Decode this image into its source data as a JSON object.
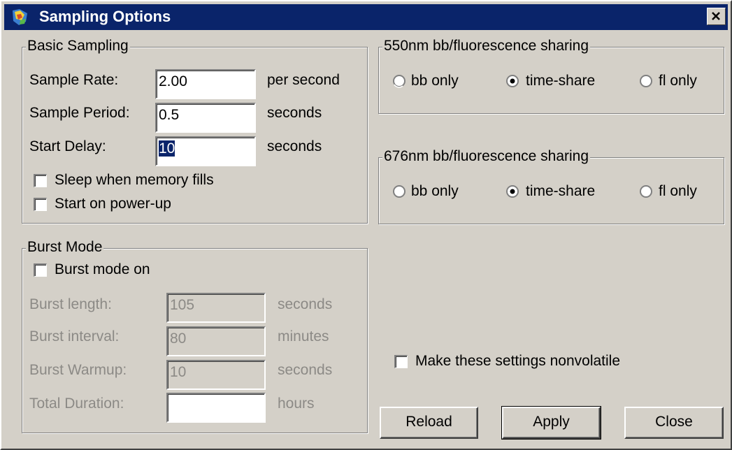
{
  "window": {
    "title": "Sampling Options",
    "close_icon": "close-icon",
    "app_icon": "app-icon"
  },
  "basic_sampling": {
    "legend": "Basic Sampling",
    "sample_rate": {
      "label": "Sample Rate:",
      "value": "2.00",
      "unit": "per second"
    },
    "sample_period": {
      "label": "Sample Period:",
      "value": "0.5",
      "unit": "seconds"
    },
    "start_delay": {
      "label": "Start Delay:",
      "value": "10",
      "unit": "seconds",
      "selected": true
    },
    "sleep_when_memory_fills": {
      "label": "Sleep when memory fills",
      "checked": false
    },
    "start_on_power_up": {
      "label": "Start on power-up",
      "checked": false
    }
  },
  "burst_mode": {
    "legend": "Burst Mode",
    "burst_mode_on": {
      "label": "Burst mode on",
      "checked": false
    },
    "burst_length": {
      "label": "Burst length:",
      "value": "105",
      "unit": "seconds"
    },
    "burst_interval": {
      "label": "Burst interval:",
      "value": "80",
      "unit": "minutes"
    },
    "burst_warmup": {
      "label": "Burst Warmup:",
      "value": "10",
      "unit": "seconds"
    },
    "total_duration": {
      "label": "Total Duration:",
      "value": "",
      "unit": "hours"
    }
  },
  "sharing_550": {
    "legend": "550nm bb/fluorescence sharing",
    "options": [
      {
        "label": "bb only",
        "selected": false
      },
      {
        "label": "time-share",
        "selected": true
      },
      {
        "label": "fl only",
        "selected": false
      }
    ]
  },
  "sharing_676": {
    "legend": "676nm bb/fluorescence sharing",
    "options": [
      {
        "label": "bb only",
        "selected": false
      },
      {
        "label": "time-share",
        "selected": true
      },
      {
        "label": "fl only",
        "selected": false
      }
    ]
  },
  "nonvolatile": {
    "label": "Make these settings nonvolatile",
    "checked": false
  },
  "buttons": {
    "reload": "Reload",
    "apply": "Apply",
    "close": "Close"
  },
  "colors": {
    "title_bar": "#0a246a",
    "face": "#d4d0c8",
    "disabled_text": "#8c8a86",
    "selection": "#0a246a"
  }
}
